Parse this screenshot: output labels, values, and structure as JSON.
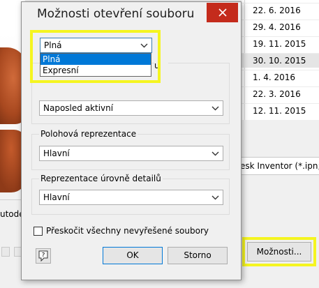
{
  "background_window": {
    "dates": [
      "22. 6. 2016",
      "29. 4. 2016",
      "19. 11. 2015",
      "30. 10. 2015",
      "1. 4. 2016",
      "22. 3. 2016",
      "12. 11. 2015"
    ],
    "selected_date_index": 3,
    "left_label": "utode",
    "file_type_text": "esk Inventor (*.ipn;*",
    "moznosti_button": "Možnosti..."
  },
  "dialog": {
    "title": "Možnosti otevření souboru",
    "close_label": "✕",
    "top_combo": {
      "value": "Plná",
      "options": [
        "Plná",
        "Expresní"
      ],
      "selected_option_index": 0
    },
    "hidden_group_label_tail": "u",
    "model_combo": {
      "value": "Naposled aktivní"
    },
    "positional_group": {
      "label": "Polohová reprezentace",
      "value": "Hlavní"
    },
    "detail_group": {
      "label": "Reprezentace úrovně detailů",
      "value": "Hlavní"
    },
    "skip_checkbox": {
      "label": "Přeskočit všechny nevyřešené soubory",
      "checked": false
    },
    "ok_label": "OK",
    "cancel_label": "Storno"
  },
  "colors": {
    "highlight_yellow": "#f5f520",
    "close_red": "#c42b1c",
    "selection_blue": "#0078d7"
  },
  "icons": [
    "close-icon",
    "chevron-down-icon",
    "help-icon"
  ]
}
